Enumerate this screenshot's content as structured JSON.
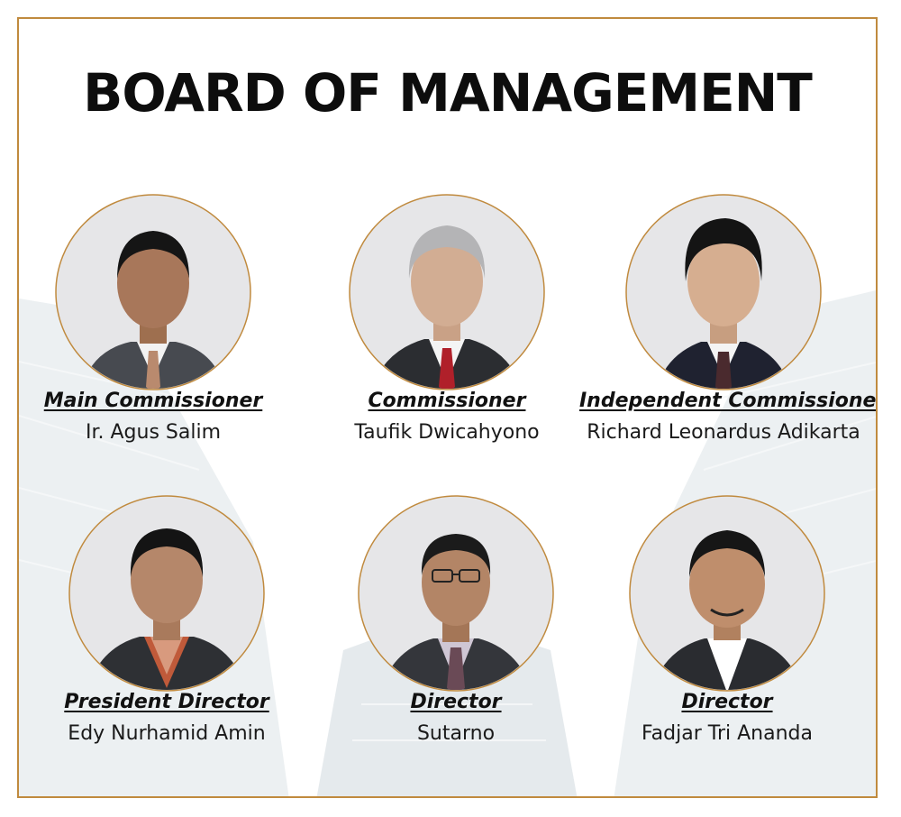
{
  "title": "BOARD OF MANAGEMENT",
  "colors": {
    "border": "#c08a3e",
    "title": "#0d0d0d",
    "photo_bg": "#e6e6e8"
  },
  "members": [
    {
      "role": "Main Commissioner",
      "name": "Ir. Agus Salim",
      "tie": "#b98a6e",
      "suit": "#474a50"
    },
    {
      "role": "Commissioner",
      "name": "Taufik Dwicahyono",
      "tie": "#b0202a",
      "suit": "#2b2d31"
    },
    {
      "role": "Independent Commissioner",
      "name": "Richard Leonardus Adikarta",
      "tie": "#4a2a2e",
      "suit": "#1f2230"
    },
    {
      "role": "President Director",
      "name": "Edy Nurhamid Amin",
      "tie": "#c05a3a",
      "suit": "#2e3034"
    },
    {
      "role": "Director",
      "name": "Sutarno",
      "tie": "#6a4a56",
      "suit": "#34363b"
    },
    {
      "role": "Director",
      "name": "Fadjar Tri Ananda",
      "tie": "#ffffff",
      "suit": "#2a2c30"
    }
  ]
}
